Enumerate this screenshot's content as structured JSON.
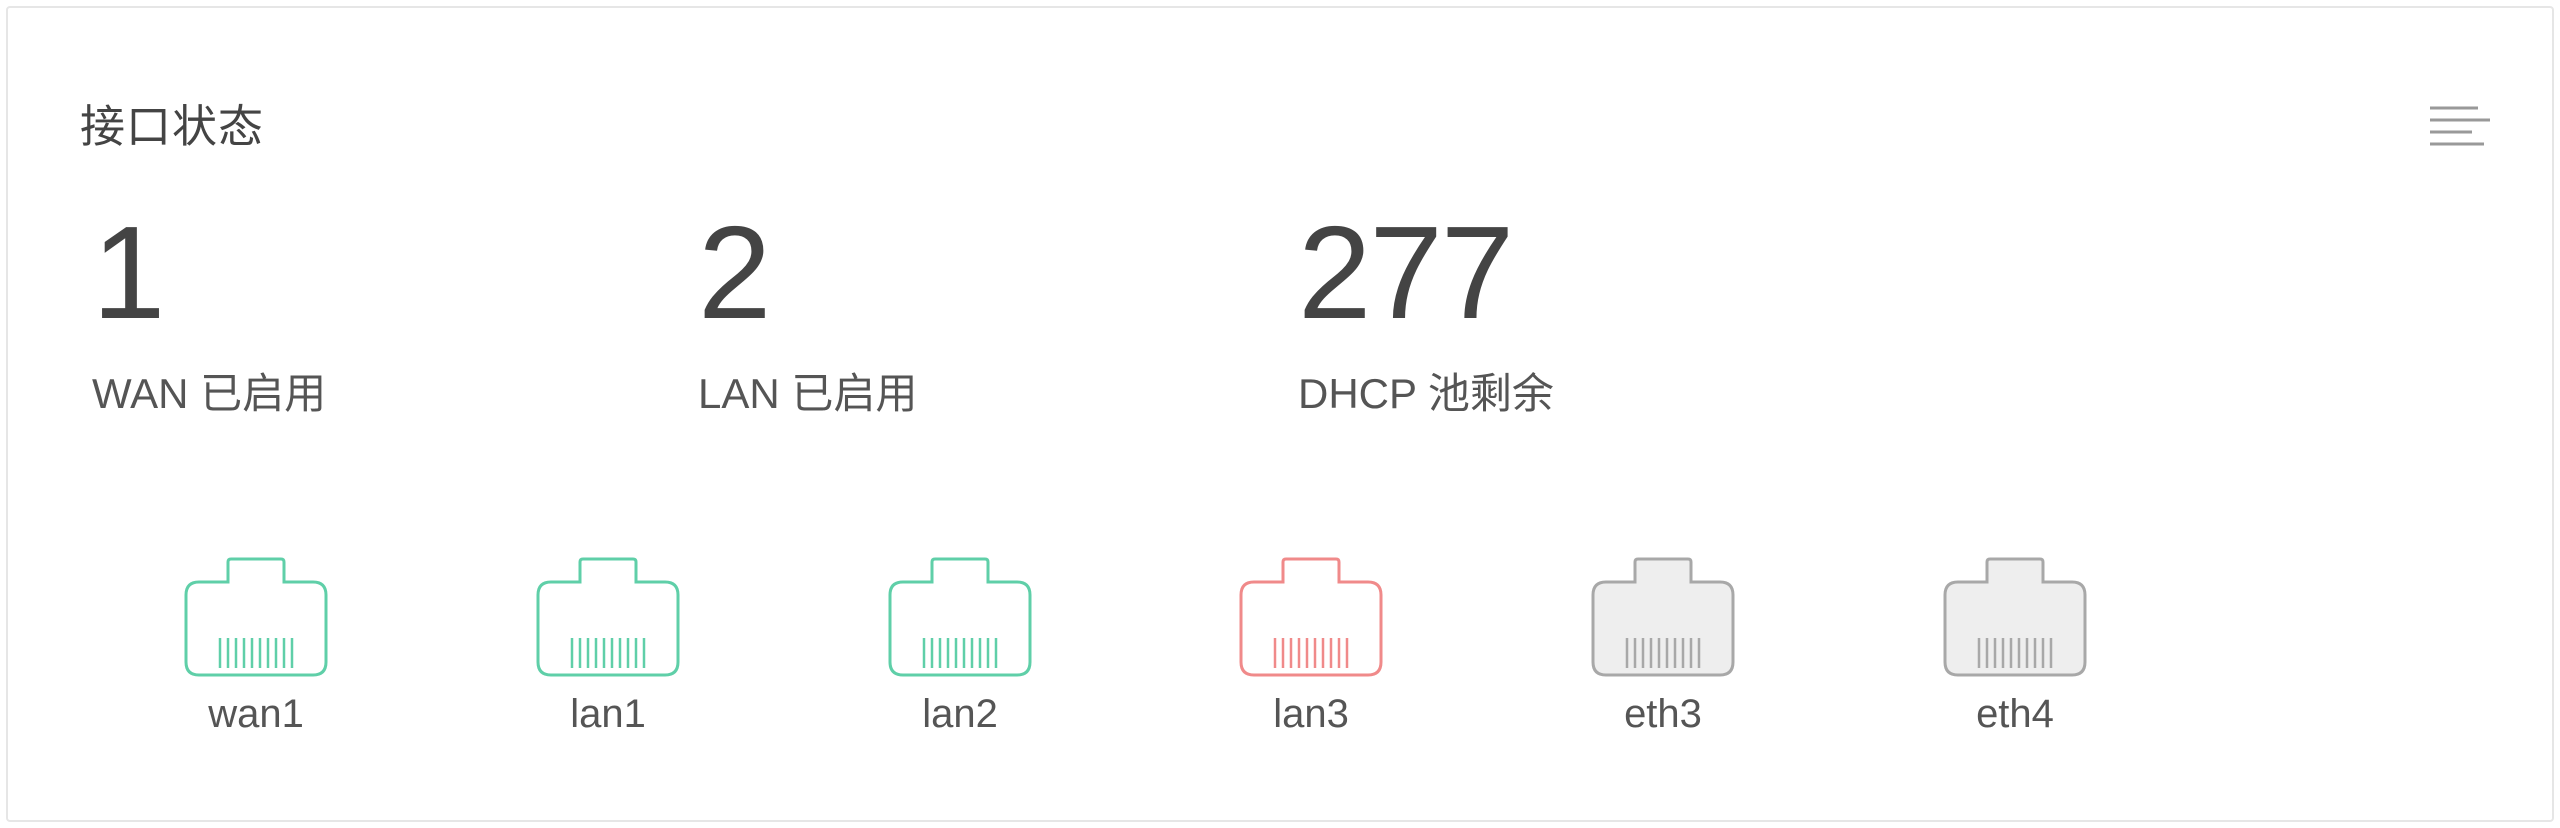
{
  "panel": {
    "title": "接口状态",
    "menu_icon": "menu-lines-icon"
  },
  "stats": {
    "wan": {
      "value": "1",
      "label": "WAN 已启用"
    },
    "lan": {
      "value": "2",
      "label": "LAN 已启用"
    },
    "dhcp": {
      "value": "277",
      "label": "DHCP 池剩余"
    }
  },
  "ports": [
    {
      "label": "wan1",
      "status": "connected",
      "icon": "ethernet-port-icon"
    },
    {
      "label": "lan1",
      "status": "connected",
      "icon": "ethernet-port-icon"
    },
    {
      "label": "lan2",
      "status": "connected",
      "icon": "ethernet-port-icon"
    },
    {
      "label": "lan3",
      "status": "error",
      "icon": "ethernet-port-icon"
    },
    {
      "label": "eth3",
      "status": "inactive",
      "icon": "ethernet-port-icon"
    },
    {
      "label": "eth4",
      "status": "inactive",
      "icon": "ethernet-port-icon"
    }
  ],
  "colors": {
    "connected": "#5fcfa8",
    "error": "#f08a8a",
    "inactive": "#a8a8a8",
    "inactive_fill": "#eeeeee",
    "active_fill": "#ffffff"
  }
}
